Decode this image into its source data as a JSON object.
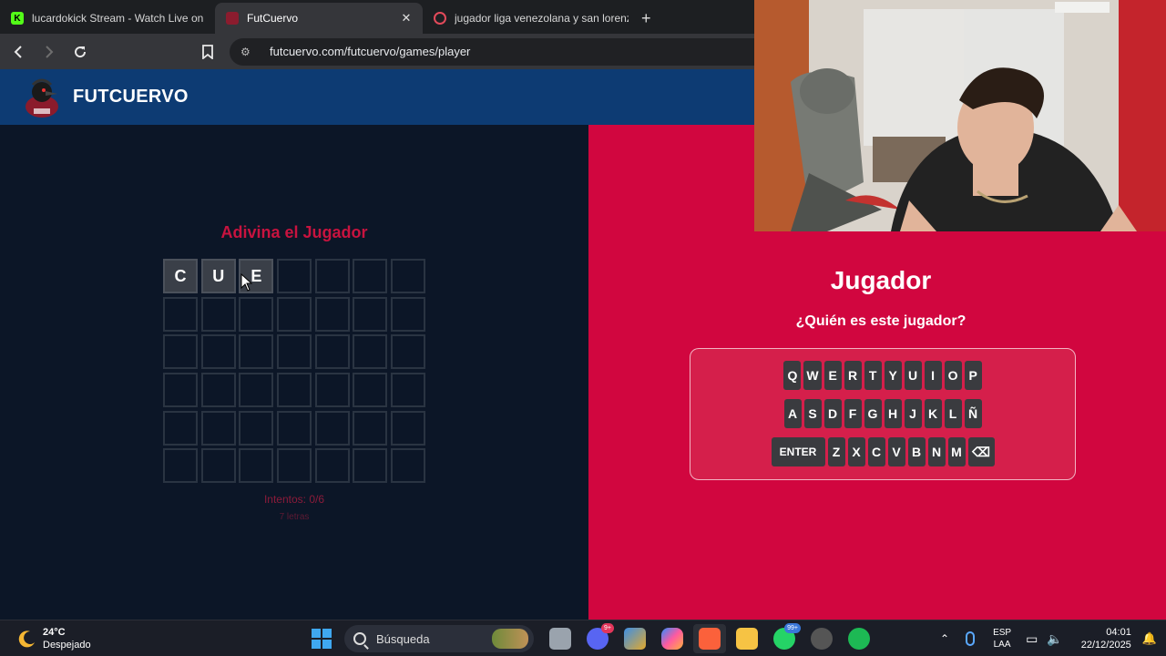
{
  "browser": {
    "tabs": [
      {
        "title": "lucardokick Stream - Watch Live on K",
        "favicon": "kick-logo-icon",
        "active": false
      },
      {
        "title": "FutCuervo",
        "favicon": "futcuervo-favicon-icon",
        "active": true
      },
      {
        "title": "jugador liga venezolana y san lorenz",
        "favicon": "search-favicon-icon",
        "active": false
      }
    ],
    "close_glyph": "✕",
    "new_tab_glyph": "+",
    "url": "futcuervo.com/futcuervo/games/player"
  },
  "site": {
    "brand": "FUTCUERVO"
  },
  "game": {
    "title": "Adivina el Jugador",
    "grid": [
      [
        "C",
        "U",
        "E",
        "",
        "",
        "",
        ""
      ],
      [
        "",
        "",
        "",
        "",
        "",
        "",
        ""
      ],
      [
        "",
        "",
        "",
        "",
        "",
        "",
        ""
      ],
      [
        "",
        "",
        "",
        "",
        "",
        "",
        ""
      ],
      [
        "",
        "",
        "",
        "",
        "",
        "",
        ""
      ],
      [
        "",
        "",
        "",
        "",
        "",
        "",
        ""
      ]
    ],
    "attempts": "Intentos: 0/6",
    "letters": "7 letras"
  },
  "panel": {
    "title": "Jugador",
    "subtitle": "¿Quién es este jugador?",
    "keyboard": {
      "row1": [
        "Q",
        "W",
        "E",
        "R",
        "T",
        "Y",
        "U",
        "I",
        "O",
        "P"
      ],
      "row2": [
        "A",
        "S",
        "D",
        "F",
        "G",
        "H",
        "J",
        "K",
        "L",
        "Ñ"
      ],
      "row3": [
        "ENTER",
        "Z",
        "X",
        "C",
        "V",
        "B",
        "N",
        "M",
        "⌫"
      ]
    }
  },
  "taskbar": {
    "weather_temp": "24°C",
    "weather_desc": "Despejado",
    "search_placeholder": "Búsqueda",
    "discord_badge": "9+",
    "whatsapp_badge": "99+",
    "chevron_glyph": "⌃",
    "lang_top": "ESP",
    "lang_bottom": "LAA",
    "network_glyph": "▭",
    "volume_glyph": "🔈",
    "notif_glyph": "🔔",
    "time": "04:01",
    "date": "22/12/2025"
  },
  "colors": {
    "accent_red": "#d1063f",
    "header_blue": "#0d3b73",
    "game_bg": "#0c1627"
  }
}
